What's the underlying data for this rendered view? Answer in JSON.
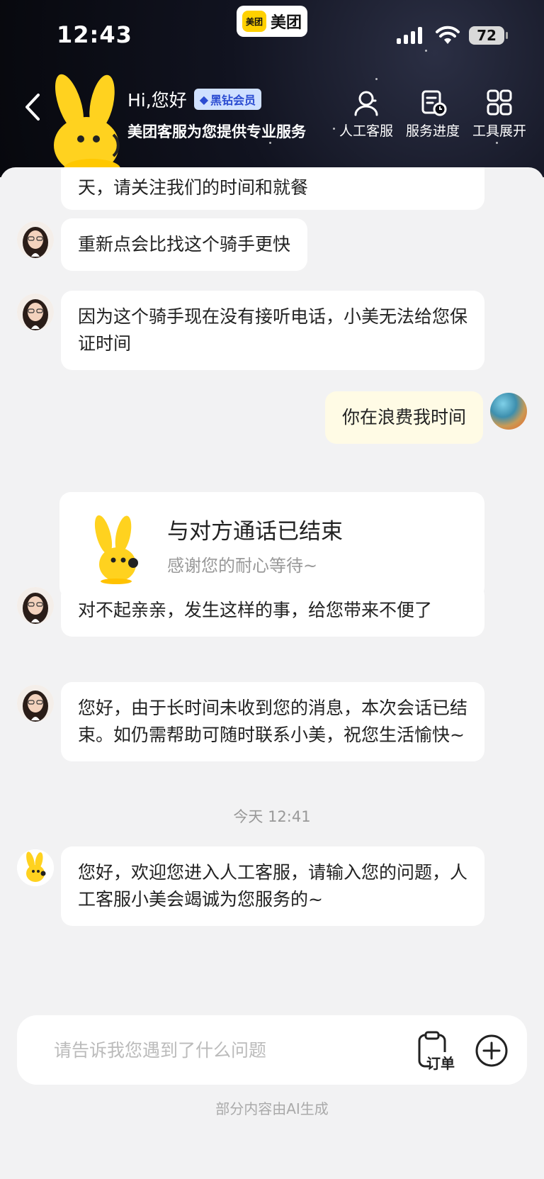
{
  "status_bar": {
    "time": "12:43",
    "app_name": "美团",
    "app_logo_text": "美团",
    "battery": "72"
  },
  "header": {
    "greeting": "Hi,您好",
    "vip_badge": "黑钻会员",
    "subtitle": "美团客服为您提供专业服务",
    "tools": [
      {
        "label": "人工客服",
        "icon": "agent-icon"
      },
      {
        "label": "服务进度",
        "icon": "progress-icon"
      },
      {
        "label": "工具展开",
        "icon": "grid-icon"
      }
    ]
  },
  "messages": [
    {
      "sender": "agent",
      "text": "天，请关注我们的时间和就餐"
    },
    {
      "sender": "agent",
      "text": "重新点会比找这个骑手更快"
    },
    {
      "sender": "agent",
      "text": "因为这个骑手现在没有接听电话，小美无法给您保证时间"
    },
    {
      "sender": "user",
      "text": "你在浪费我时间"
    },
    {
      "sender": "agent",
      "text": "对不起亲亲，发生这样的事，给您带来不便了"
    },
    {
      "sender": "agent",
      "text": "您好，由于长时间未收到您的消息，本次会话已结束。如仍需帮助可随时联系小美，祝您生活愉快~"
    },
    {
      "sender": "bot",
      "text": "您好，欢迎您进入人工客服，请输入您的问题，人工客服小美会竭诚为您服务的~"
    }
  ],
  "call_card": {
    "title": "与对方通话已结束",
    "subtitle": "感谢您的耐心等待~"
  },
  "timestamp": "今天 12:41",
  "input": {
    "placeholder": "请告诉我您遇到了什么问题",
    "order_label": "订单"
  },
  "footer_note": "部分内容由AI生成",
  "colors": {
    "accent": "#ffd100",
    "user_bubble": "#fffbe5",
    "header_bg": "#0b0c14"
  }
}
